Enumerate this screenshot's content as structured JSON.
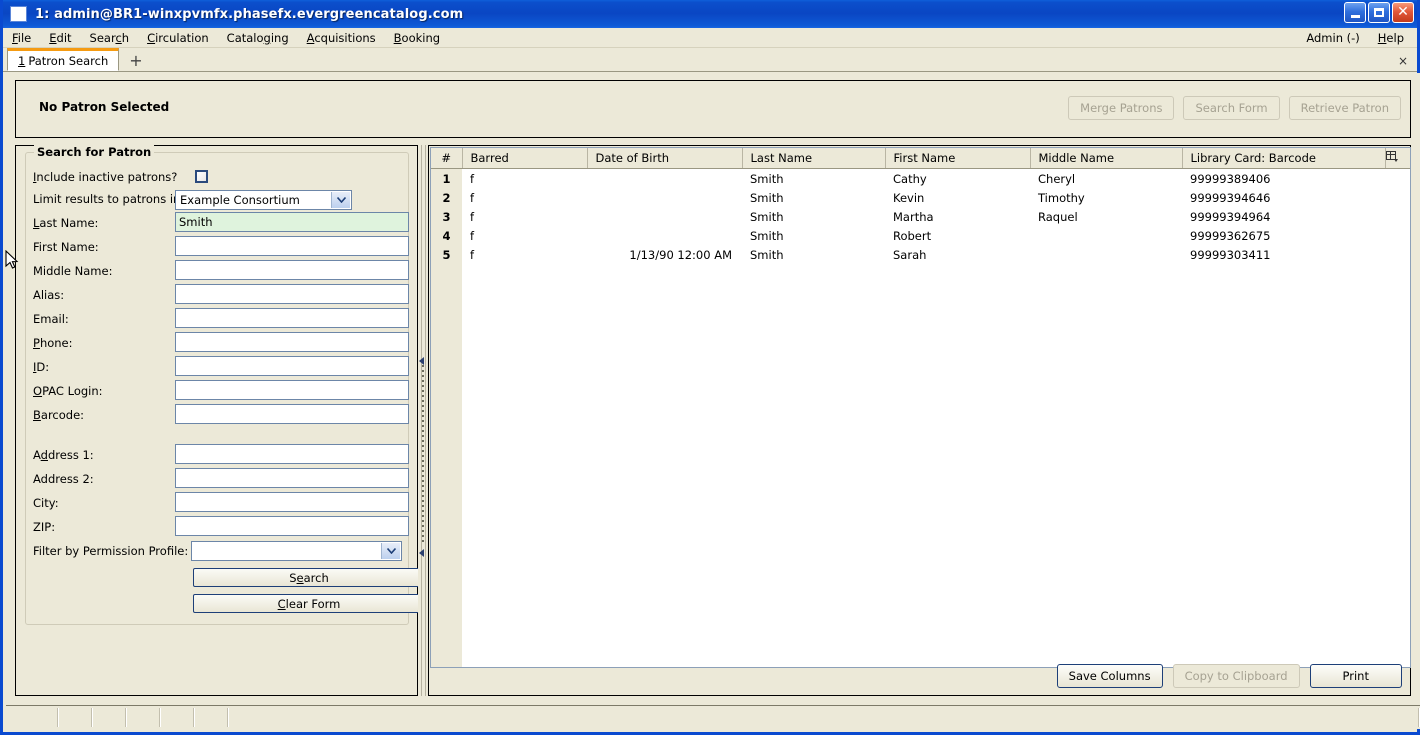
{
  "window": {
    "title": "1: admin@BR1-winxpvmfx.phasefx.evergreencatalog.com",
    "minimize_label": "Minimize",
    "maximize_label": "Maximize",
    "close_label": "Close"
  },
  "menubar": {
    "items": [
      {
        "label": "File",
        "accel": "F"
      },
      {
        "label": "Edit",
        "accel": "E"
      },
      {
        "label": "Search",
        "accel": "c"
      },
      {
        "label": "Circulation",
        "accel": "C"
      },
      {
        "label": "Cataloging",
        "accel": "g"
      },
      {
        "label": "Acquisitions",
        "accel": "A"
      },
      {
        "label": "Booking",
        "accel": "B"
      }
    ],
    "right_items": [
      {
        "label": "Admin (-)"
      },
      {
        "label": "Help"
      }
    ]
  },
  "tabstrip": {
    "tab_number": "1",
    "tab_label": "Patron Search",
    "new_tab_icon": "plus-icon",
    "close_icon": "×"
  },
  "patron_bar": {
    "status": "No Patron Selected",
    "buttons": [
      {
        "label": "Merge Patrons",
        "disabled": true
      },
      {
        "label": "Search Form",
        "disabled": true
      },
      {
        "label": "Retrieve Patron",
        "disabled": true
      }
    ]
  },
  "search_form": {
    "legend": "Search for Patron",
    "include_inactive_label": "Include inactive patrons?",
    "include_inactive_checked": false,
    "limit_results_label": "Limit results to patrons in",
    "limit_results_value": "Example Consortium",
    "fields": [
      {
        "label": "Last Name:",
        "value": "Smith",
        "highlight": true
      },
      {
        "label": "First Name:",
        "value": "",
        "highlight": false
      },
      {
        "label": "Middle Name:",
        "value": "",
        "highlight": false
      },
      {
        "label": "Alias:",
        "value": "",
        "highlight": false
      },
      {
        "label": "Email:",
        "value": "",
        "highlight": false
      },
      {
        "label": "Phone:",
        "value": "",
        "highlight": false
      },
      {
        "label": "ID:",
        "value": "",
        "highlight": false
      },
      {
        "label": "OPAC Login:",
        "value": "",
        "highlight": false
      },
      {
        "label": "Barcode:",
        "value": "",
        "highlight": false
      }
    ],
    "address_fields": [
      {
        "label": "Address 1:",
        "value": ""
      },
      {
        "label": "Address 2:",
        "value": ""
      },
      {
        "label": "City:",
        "value": ""
      },
      {
        "label": "ZIP:",
        "value": ""
      }
    ],
    "permission_label": "Filter by Permission Profile:",
    "permission_value": "",
    "search_button": "Search",
    "clear_button": "Clear Form"
  },
  "results": {
    "columns": [
      "#",
      "Barred",
      "Date of Birth",
      "Last Name",
      "First Name",
      "Middle Name",
      "Library Card: Barcode"
    ],
    "column_picker_icon": "column-picker-icon",
    "rows": [
      {
        "num": "1",
        "barred": "f",
        "dob": "",
        "last": "Smith",
        "first": "Cathy",
        "middle": "Cheryl",
        "barcode": "99999389406"
      },
      {
        "num": "2",
        "barred": "f",
        "dob": "",
        "last": "Smith",
        "first": "Kevin",
        "middle": "Timothy",
        "barcode": "99999394646"
      },
      {
        "num": "3",
        "barred": "f",
        "dob": "",
        "last": "Smith",
        "first": "Martha",
        "middle": "Raquel",
        "barcode": "99999394964"
      },
      {
        "num": "4",
        "barred": "f",
        "dob": "",
        "last": "Smith",
        "first": "Robert",
        "middle": "",
        "barcode": "99999362675"
      },
      {
        "num": "5",
        "barred": "f",
        "dob": "1/13/90 12:00 AM",
        "last": "Smith",
        "first": "Sarah",
        "middle": "",
        "barcode": "99999303411"
      }
    ],
    "buttons": [
      {
        "label": "Save Columns",
        "disabled": false
      },
      {
        "label": "Copy to Clipboard",
        "disabled": true
      },
      {
        "label": "Print",
        "disabled": false
      }
    ]
  },
  "statusbar": {
    "segments": [
      "",
      "",
      "",
      "",
      "",
      "",
      ""
    ]
  },
  "colors": {
    "titlebar_blue": "#0a46c3",
    "chrome_beige": "#ece9d8",
    "tab_accent": "#f59b12",
    "field_border": "#6c86a8",
    "highlight_green": "#dff3dd"
  }
}
